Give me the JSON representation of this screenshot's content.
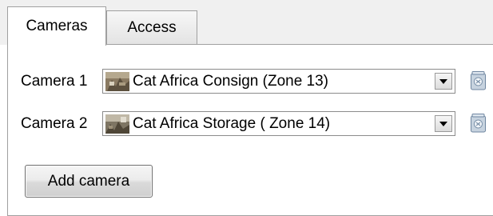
{
  "tabs": [
    {
      "label": "Cameras",
      "active": true
    },
    {
      "label": "Access",
      "active": false
    }
  ],
  "cameras": [
    {
      "label": "Camera 1",
      "value": "Cat Africa Consign (Zone 13)",
      "thumbnail_icon": "camera-thumbnail-icon",
      "delete_icon": "delete-icon"
    },
    {
      "label": "Camera 2",
      "value": "Cat Africa Storage ( Zone 14)",
      "thumbnail_icon": "camera-thumbnail-icon",
      "delete_icon": "delete-icon"
    }
  ],
  "add_button": {
    "label": "Add camera"
  },
  "colors": {
    "border": "#a0a0a0",
    "tab_strip": "#f0f0f0"
  }
}
